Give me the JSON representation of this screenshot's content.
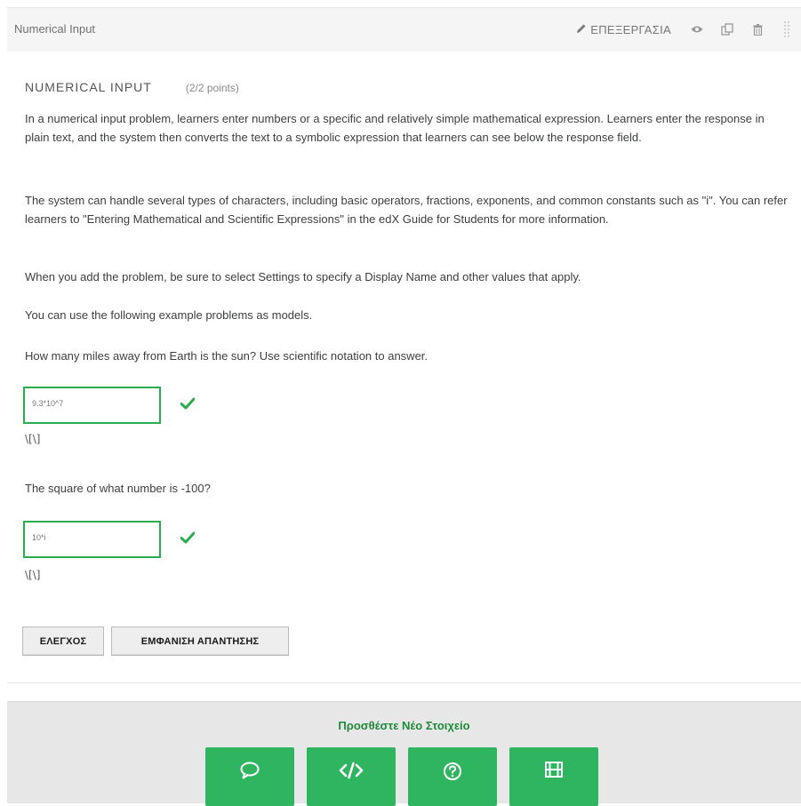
{
  "header": {
    "component_title": "Numerical Input",
    "edit_label": "ΕΠΕΞΕΡΓΑΣΙΑ",
    "icons": [
      "pencil-icon",
      "eye-icon",
      "duplicate-icon",
      "trash-icon",
      "drag-handle-icon"
    ]
  },
  "problem": {
    "title": "NUMERICAL INPUT",
    "points": "(2/2 points)",
    "paragraphs": [
      "In a numerical input problem, learners enter numbers or a specific and relatively simple mathematical expression. Learners enter the response in plain text, and the system then converts the text to a symbolic expression that learners can see below the response field.",
      "The system can handle several types of characters, including basic operators, fractions, exponents, and common constants such as \"i\". You can refer learners to \"Entering Mathematical and Scientific Expressions\" in the edX Guide for Students for more information.",
      "When you add the problem, be sure to select Settings to specify a Display Name and other values that apply.",
      "You can use the following example problems as models."
    ],
    "questions": [
      {
        "text": "How many miles away from Earth is the sun? Use scientific notation to answer.",
        "answer": "9.3*10^7",
        "preview": "\\[\\]",
        "status": "correct"
      },
      {
        "text": "The square of what number is -100?",
        "answer": "10*i",
        "preview": "\\[\\]",
        "status": "correct"
      }
    ],
    "check_label": "ΕΛΕΓΧΟΣ",
    "show_answer_label": "ΕΜΦΑΝΙΣΗ ΑΠΑΝΤΗΣΗΣ"
  },
  "add_component": {
    "title": "Προσθέστε Νέο Στοιχείο",
    "buttons": [
      "discussion-icon",
      "html-icon",
      "problem-icon",
      "video-icon"
    ]
  },
  "colors": {
    "accent_green": "#2fb560",
    "check_green": "#2bac4f",
    "add_title_green": "#1f8a3a"
  }
}
